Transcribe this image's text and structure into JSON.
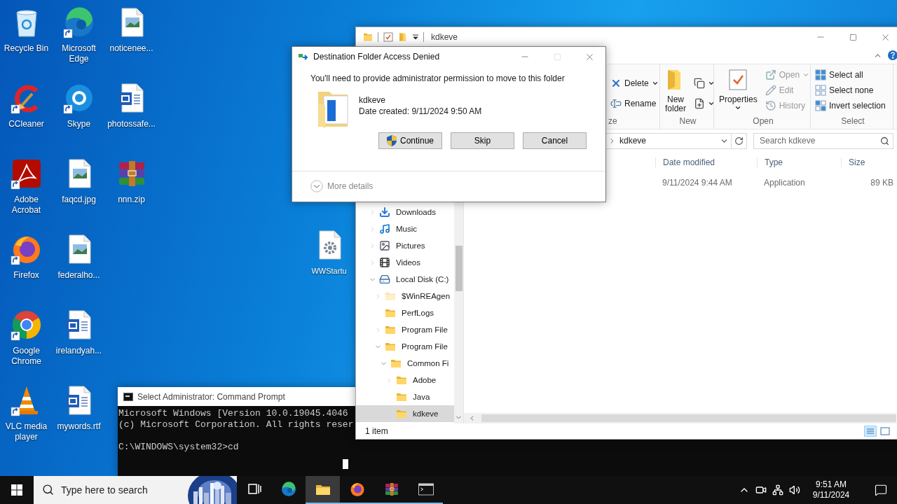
{
  "desktop": {
    "icons": [
      {
        "label": "Recycle Bin",
        "kind": "recycle-bin",
        "shortcut": false
      },
      {
        "label": "CCleaner",
        "kind": "ccleaner",
        "shortcut": true
      },
      {
        "label": "Adobe Acrobat",
        "kind": "acrobat",
        "shortcut": true
      },
      {
        "label": "Firefox",
        "kind": "firefox",
        "shortcut": true
      },
      {
        "label": "Google Chrome",
        "kind": "chrome",
        "shortcut": true
      },
      {
        "label": "VLC media player",
        "kind": "vlc",
        "shortcut": true
      },
      {
        "label": "Microsoft Edge",
        "kind": "edge",
        "shortcut": true
      },
      {
        "label": "Skype",
        "kind": "skype",
        "shortcut": true
      },
      {
        "label": "faqcd.jpg",
        "kind": "image-file",
        "shortcut": false
      },
      {
        "label": "federalho...",
        "kind": "image-file",
        "shortcut": false
      },
      {
        "label": "irelandyah...",
        "kind": "word-file",
        "shortcut": false
      },
      {
        "label": "mywords.rtf",
        "kind": "word-file",
        "shortcut": false
      },
      {
        "label": "noticenee...",
        "kind": "image-file",
        "shortcut": false
      },
      {
        "label": "photossafe...",
        "kind": "word-file",
        "shortcut": false
      },
      {
        "label": "nnn.zip",
        "kind": "archive",
        "shortcut": false
      }
    ],
    "partial_icons": [
      {
        "label": "WWStartu",
        "kind": "gear-file",
        "shortcut": false
      }
    ]
  },
  "command_prompt": {
    "title": "Select Administrator: Command Prompt",
    "output": [
      "Microsoft Windows [Version 10.0.19045.4046",
      "(c) Microsoft Corporation. All rights reser"
    ],
    "prompt": "C:\\WINDOWS\\system32>cd"
  },
  "explorer": {
    "title": "kdkeve",
    "ribbon": {
      "groups": [
        {
          "label": "ze",
          "items": [
            {
              "label": "Delete",
              "kind": "delete",
              "dropdown": true,
              "disabled": false
            },
            {
              "label": "Rename",
              "kind": "rename",
              "dropdown": false,
              "disabled": false
            }
          ]
        },
        {
          "label": "New",
          "items": [
            {
              "label": "New folder",
              "kind": "new-folder",
              "dropdown": false,
              "disabled": false
            },
            {
              "kind": "copy-path",
              "dropdown": true,
              "disabled": false
            },
            {
              "kind": "new-item",
              "dropdown": true,
              "disabled": false
            }
          ]
        },
        {
          "label": "Open",
          "items": [
            {
              "label": "Properties",
              "kind": "properties",
              "dropdown": true,
              "disabled": false
            },
            {
              "label": "Open",
              "kind": "open",
              "dropdown": true,
              "disabled": true
            },
            {
              "label": "Edit",
              "kind": "edit",
              "dropdown": false,
              "disabled": true
            },
            {
              "label": "History",
              "kind": "history",
              "dropdown": false,
              "disabled": true
            }
          ]
        },
        {
          "label": "Select",
          "items": [
            {
              "label": "Select all",
              "kind": "select-all",
              "dropdown": false,
              "disabled": false
            },
            {
              "label": "Select none",
              "kind": "select-none",
              "dropdown": false,
              "disabled": false
            },
            {
              "label": "Invert selection",
              "kind": "invert-selection",
              "dropdown": false,
              "disabled": false
            }
          ]
        }
      ]
    },
    "address": "kdkeve",
    "search": {
      "placeholder": "Search kdkeve"
    },
    "nav_tree": [
      {
        "label": "Downloads",
        "kind": "downloads",
        "expanded": false,
        "selected": false
      },
      {
        "label": "Music",
        "kind": "music",
        "expanded": false,
        "selected": false
      },
      {
        "label": "Pictures",
        "kind": "pictures",
        "expanded": false,
        "selected": false
      },
      {
        "label": "Videos",
        "kind": "videos",
        "expanded": false,
        "selected": false
      },
      {
        "label": "Local Disk (C:)",
        "kind": "drive",
        "expanded": true,
        "selected": false,
        "children": [
          {
            "label": "$WinREAgen",
            "kind": "hidden-folder",
            "expanded": false,
            "selected": false
          },
          {
            "label": "PerfLogs",
            "kind": "folder",
            "selected": false
          },
          {
            "label": "Program File",
            "kind": "folder",
            "expanded": false,
            "selected": false
          },
          {
            "label": "Program File",
            "kind": "folder",
            "expanded": true,
            "selected": false,
            "children": [
              {
                "label": "Common Fi",
                "kind": "folder",
                "expanded": true,
                "selected": false,
                "children": [
                  {
                    "label": "Adobe",
                    "kind": "folder",
                    "expanded": false,
                    "selected": false
                  },
                  {
                    "label": "Java",
                    "kind": "folder",
                    "selected": false
                  },
                  {
                    "label": "kdkeve",
                    "kind": "folder",
                    "selected": true
                  }
                ]
              }
            ]
          }
        ]
      }
    ],
    "columns": [
      "Date modified",
      "Type",
      "Size"
    ],
    "rows": [
      {
        "cells": [
          "9/11/2024 9:44 AM",
          "Application",
          "89 KB"
        ]
      }
    ],
    "status": "1 item"
  },
  "dialog": {
    "title": "Destination Folder Access Denied",
    "message": "You'll need to provide administrator permission to move to this folder",
    "item_name": "kdkeve",
    "item_detail": "Date created: 9/11/2024 9:50 AM",
    "buttons": [
      {
        "label": "Continue",
        "shield": true
      },
      {
        "label": "Skip",
        "shield": false
      },
      {
        "label": "Cancel",
        "shield": false
      }
    ],
    "more_details": "More details"
  },
  "taskbar": {
    "search_placeholder": "Type here to search",
    "apps": [
      {
        "kind": "task-view",
        "selected": false,
        "running": false
      },
      {
        "kind": "edge",
        "selected": false,
        "running": false
      },
      {
        "kind": "folder",
        "selected": true,
        "running": true
      },
      {
        "kind": "firefox",
        "selected": false,
        "running": true
      },
      {
        "kind": "archive",
        "selected": false,
        "running": true
      },
      {
        "kind": "terminal",
        "selected": false,
        "running": true
      }
    ],
    "time": "9:51 AM",
    "date": "9/11/2024"
  }
}
